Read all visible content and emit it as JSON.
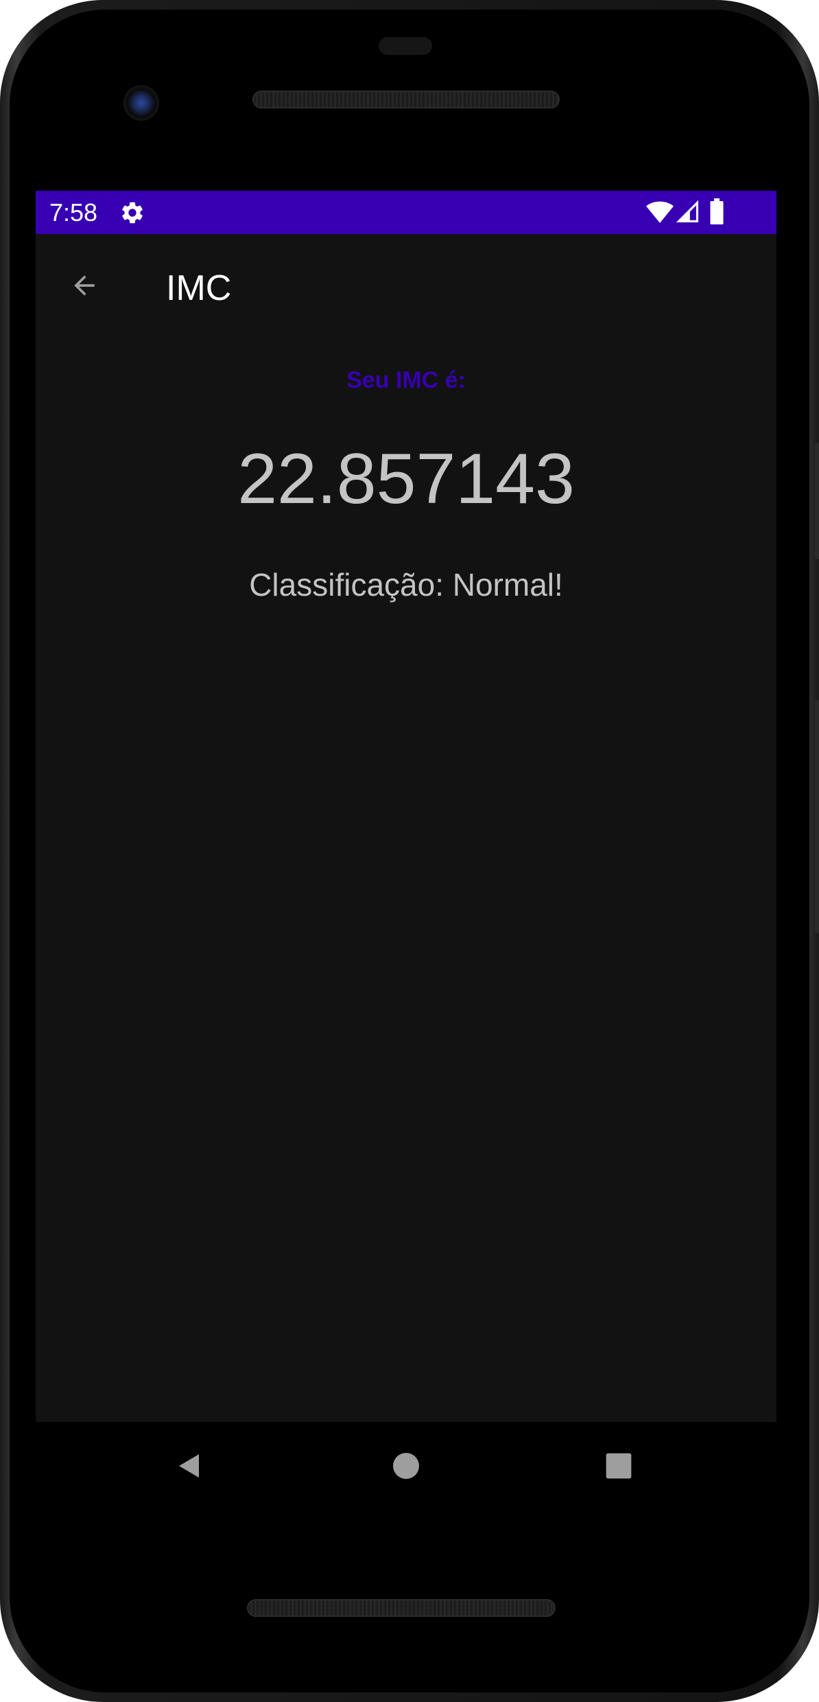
{
  "status_bar": {
    "time": "7:58",
    "background_color": "#3700b3",
    "icons": [
      "gear-icon",
      "wifi-icon",
      "cell-signal-icon",
      "battery-icon"
    ]
  },
  "app_bar": {
    "title": "IMC",
    "back_icon": "arrow-back-icon"
  },
  "result": {
    "label": "Seu IMC é:",
    "value": "22.857143",
    "classification": "Classificação: Normal!",
    "label_color": "#3700b3"
  },
  "nav_bar": {
    "icons": [
      "nav-back-icon",
      "nav-home-icon",
      "nav-recents-icon"
    ]
  }
}
